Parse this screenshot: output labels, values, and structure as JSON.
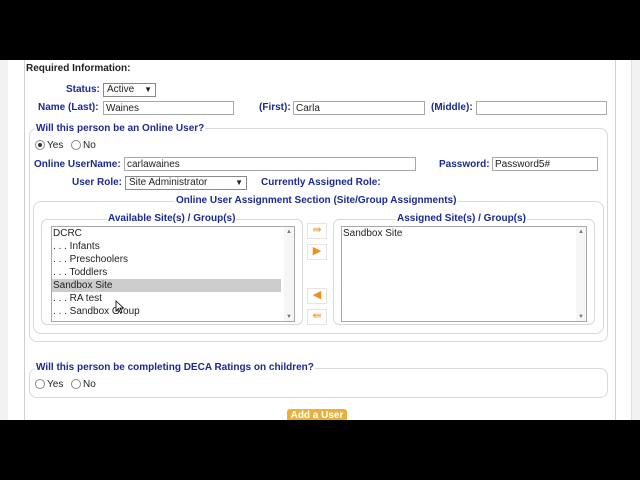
{
  "required_heading": "Required Information:",
  "status": {
    "label": "Status:",
    "value": "Active"
  },
  "name": {
    "last_label": "Name (Last):",
    "last_value": "Waines",
    "first_label": "(First):",
    "first_value": "Carla",
    "middle_label": "(Middle):",
    "middle_value": ""
  },
  "online_user": {
    "question": "Will this person be an Online User?",
    "yes": "Yes",
    "no": "No",
    "selected": "Yes",
    "username_label": "Online UserName:",
    "username_value": "carlawaines",
    "password_label": "Password:",
    "password_value": "Password5#",
    "role_label": "User Role:",
    "role_value": "Site Administrator",
    "currently_assigned_label": "Currently Assigned Role:"
  },
  "assignment": {
    "section_title": "Online User Assignment Section (Site/Group Assignments)",
    "available_label": "Available Site(s) / Group(s)",
    "assigned_label": "Assigned Site(s) / Group(s)",
    "available_items": [
      "DCRC",
      ". . . Infants",
      ". . . Preschoolers",
      ". . . Toddlers",
      "Sandbox Site",
      ". . . RA test",
      ". . . Sandbox Group"
    ],
    "selected_available": "Sandbox Site",
    "assigned_items": [
      "Sandbox Site"
    ],
    "buttons": [
      "move-all-right-icon",
      "move-right-icon",
      "move-left-icon",
      "move-all-left-icon"
    ]
  },
  "deca": {
    "question": "Will this person be completing DECA Ratings on children?",
    "yes": "Yes",
    "no": "No"
  },
  "add_button": "Add a User",
  "colors": {
    "label_blue": "#1c2a8f",
    "accent_orange": "#f0901a",
    "button_gold": "#e8b23a"
  }
}
